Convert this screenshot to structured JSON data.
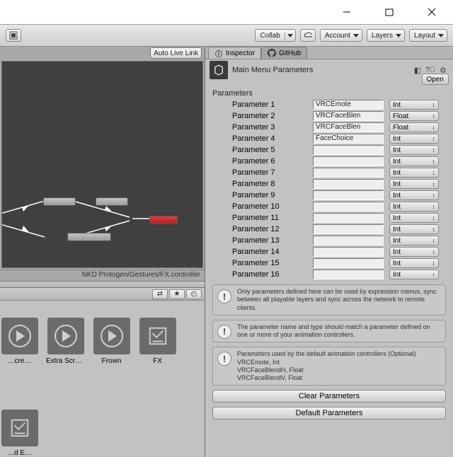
{
  "toolbar": {
    "collab": "Collab",
    "account": "Account",
    "layers": "Layers",
    "layout": "Layout",
    "auto_live_link": "Auto Live Link",
    "asset_path": "NKD Protogen/Gestures/FX.controller"
  },
  "tabs": {
    "inspector": "Inspector",
    "github": "GitHub"
  },
  "inspector": {
    "title": "Main Menu Parameters",
    "open": "Open",
    "section": "Parameters",
    "parameters": [
      {
        "label": "Parameter 1",
        "value": "VRCEmote",
        "type": "Int"
      },
      {
        "label": "Parameter 2",
        "value": "VRCFaceBlen",
        "type": "Float"
      },
      {
        "label": "Parameter 3",
        "value": "VRCFaceBlen",
        "type": "Float"
      },
      {
        "label": "Parameter 4",
        "value": "FaceChoice",
        "type": "Int"
      },
      {
        "label": "Parameter 5",
        "value": "",
        "type": "Int"
      },
      {
        "label": "Parameter 6",
        "value": "",
        "type": "Int"
      },
      {
        "label": "Parameter 7",
        "value": "",
        "type": "Int"
      },
      {
        "label": "Parameter 8",
        "value": "",
        "type": "Int"
      },
      {
        "label": "Parameter 9",
        "value": "",
        "type": "Int"
      },
      {
        "label": "Parameter 10",
        "value": "",
        "type": "Int"
      },
      {
        "label": "Parameter 11",
        "value": "",
        "type": "Int"
      },
      {
        "label": "Parameter 12",
        "value": "",
        "type": "Int"
      },
      {
        "label": "Parameter 13",
        "value": "",
        "type": "Int"
      },
      {
        "label": "Parameter 14",
        "value": "",
        "type": "Int"
      },
      {
        "label": "Parameter 15",
        "value": "",
        "type": "Int"
      },
      {
        "label": "Parameter 16",
        "value": "",
        "type": "Int"
      }
    ],
    "info1": "Only parameters defined here can be used by expression menus, sync between all playable layers and sync across the network to remote clients.",
    "info2": "The parameter name and type should match a parameter defined on one or more of your animation controllers.",
    "info3_title": "Parameters used by the default animation controllers (Optional)",
    "info3_l1": "VRCEmote, Int",
    "info3_l2": "VRCFaceBlendH, Float",
    "info3_l3": "VRCFaceBlendV, Float",
    "clear": "Clear Parameters",
    "defaults": "Default Parameters"
  },
  "assets": [
    {
      "label": "…cre…",
      "kind": "play"
    },
    {
      "label": "Extra Scre…",
      "kind": "play"
    },
    {
      "label": "Frown",
      "kind": "play"
    },
    {
      "label": "FX",
      "kind": "fx"
    }
  ],
  "asset2": {
    "label": "…d E…",
    "kind": "fx"
  }
}
